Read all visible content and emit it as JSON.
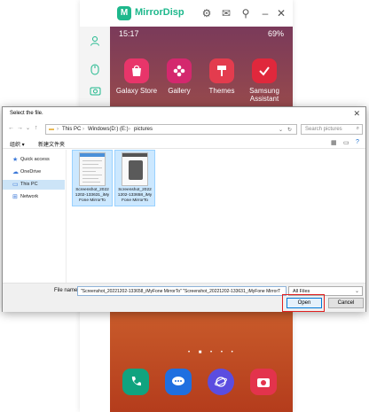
{
  "app": {
    "name": "MirrorDisp",
    "titlebar_icons": [
      "settings-icon",
      "mail-icon",
      "pin-icon",
      "minimize-icon",
      "close-icon"
    ],
    "side_icons": [
      "user-icon",
      "mouse-icon",
      "camera-icon"
    ]
  },
  "phone": {
    "status_time": "15:17",
    "status_right": "69%",
    "apps": [
      {
        "label": "Galaxy Store",
        "icon": "galaxy-store-icon",
        "color": "#e8356a"
      },
      {
        "label": "Gallery",
        "icon": "gallery-icon",
        "color": "#d4286e"
      },
      {
        "label": "Themes",
        "icon": "themes-icon",
        "color": "#e33c4e"
      },
      {
        "label": "Samsung Assistant",
        "icon": "samsung-assistant-icon",
        "color": "#e0283c"
      }
    ],
    "dock": [
      {
        "icon": "phone-icon",
        "color": "#10a37f"
      },
      {
        "icon": "messages-icon",
        "color": "#1f6fe0"
      },
      {
        "icon": "internet-icon",
        "color": "#5b4de0"
      },
      {
        "icon": "camera-icon",
        "color": "#e3334c"
      }
    ]
  },
  "dialog": {
    "title": "Select the file.",
    "breadcrumb": [
      "This PC",
      "Windows(D:) (E:)",
      "pictures"
    ],
    "search_placeholder": "Search pictures",
    "organize": "组织 ▾",
    "new_folder": "新建文件夹",
    "nav_items": [
      {
        "label": "Quick access",
        "icon": "star-icon"
      },
      {
        "label": "OneDrive",
        "icon": "cloud-icon"
      },
      {
        "label": "This PC",
        "icon": "computer-icon",
        "selected": true
      },
      {
        "label": "Network",
        "icon": "network-icon"
      }
    ],
    "files": [
      {
        "name": "Screenshot_2022 1202-133631_iMy Fone MirrorTo"
      },
      {
        "name": "Screenshot_2022 1202-133658_iMy Fone MirrorTo"
      }
    ],
    "file_name_label": "File name:",
    "file_name_value": "\"Screenshot_20221202-133658_iMyFone MirrorTo\" \"Screenshot_20221202-133631_iMyFone MirrorT",
    "filter": "All Files",
    "open_label": "Open",
    "cancel_label": "Cancel"
  }
}
